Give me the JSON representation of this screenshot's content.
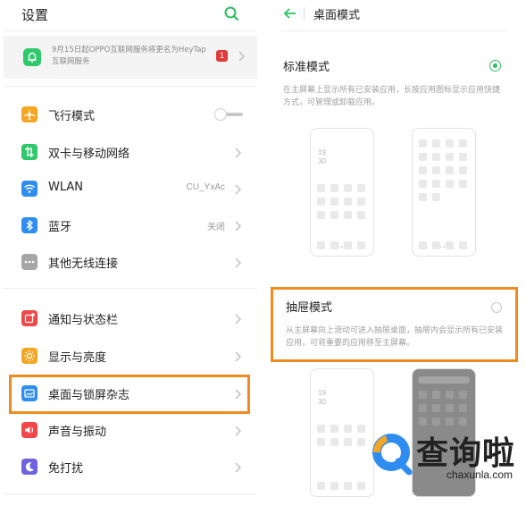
{
  "left": {
    "title": "设置",
    "notice": {
      "text": "9月15日起OPPO互联网服务将更名为HeyTap互联网服务",
      "badge": "1"
    },
    "items": [
      {
        "label": "飞行模式",
        "value": "",
        "icon": "airplane-icon",
        "color": "#f5a623"
      },
      {
        "label": "双卡与移动网络",
        "value": "",
        "icon": "dual-sim-icon",
        "color": "#2fc86a"
      },
      {
        "label": "WLAN",
        "value": "CU_YxAc",
        "icon": "wifi-icon",
        "color": "#2f8cf0"
      },
      {
        "label": "蓝牙",
        "value": "关闭",
        "icon": "bluetooth-icon",
        "color": "#2f8cf0"
      },
      {
        "label": "其他无线连接",
        "value": "",
        "icon": "more-connections-icon",
        "color": "#a6a6a6"
      },
      {
        "label": "通知与状态栏",
        "value": "",
        "icon": "notification-icon",
        "color": "#f04848"
      },
      {
        "label": "显示与亮度",
        "value": "",
        "icon": "brightness-icon",
        "color": "#f5a623"
      },
      {
        "label": "桌面与锁屏杂志",
        "value": "",
        "icon": "desktop-icon",
        "color": "#2f8cf0"
      },
      {
        "label": "声音与振动",
        "value": "",
        "icon": "sound-icon",
        "color": "#f04848"
      },
      {
        "label": "免打扰",
        "value": "",
        "icon": "do-not-disturb-icon",
        "color": "#6f62e0"
      }
    ]
  },
  "right": {
    "title": "桌面模式",
    "standard": {
      "title": "标准模式",
      "desc": "在主屏幕上显示所有已安装应用，长按应用图标显示应用快捷方式，可管理或卸载应用。",
      "selected": true
    },
    "drawer": {
      "title": "抽屉模式",
      "desc": "从主屏幕向上滑动可进入抽屉桌面，抽屉内会显示所有已安装应用，可将重要的应用移至主屏幕。",
      "selected": false
    },
    "preview_clock": [
      "19",
      "30"
    ]
  },
  "watermark": {
    "cn": "查询啦",
    "en": "chaxunla.com"
  },
  "colors": {
    "accent": "#2fbf5e",
    "highlight": "#f08c1e"
  }
}
